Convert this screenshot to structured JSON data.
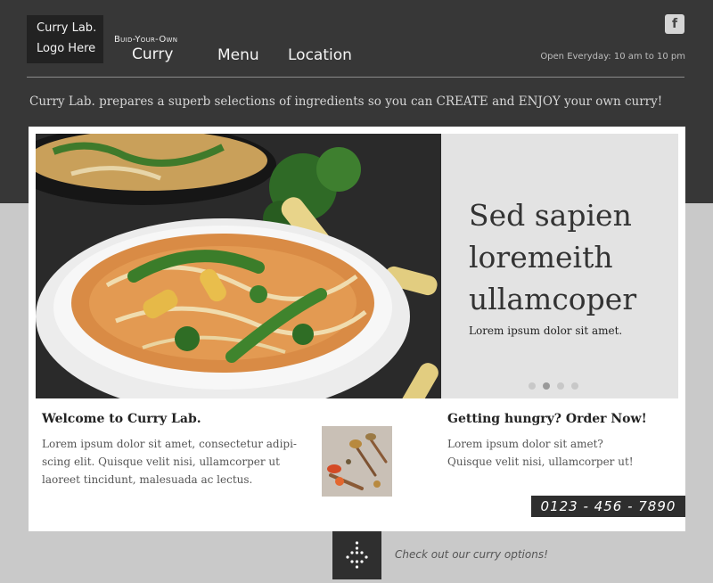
{
  "header": {
    "logo_line1": "Curry Lab.",
    "logo_line2": "Logo Here",
    "nav_build_sub": "Buid-Your-Own",
    "nav_build_main": "Curry",
    "nav_menu": "Menu",
    "nav_location": "Location",
    "social_icon": "facebook-icon",
    "social_glyph": "f",
    "hours": "Open Everyday: 10 am to 10 pm"
  },
  "tagline": "Curry Lab. prepares a superb selections of ingredients so  you can CREATE and ENJOY your own curry!",
  "hero": {
    "headline_line1": "Sed sapien",
    "headline_line2": "loremeith",
    "headline_line3": "ullamcoper",
    "subtext": "Lorem ipsum dolor sit amet.",
    "slide_count": 4,
    "active_slide": 2
  },
  "welcome": {
    "title": "Welcome to Curry Lab.",
    "line1": "Lorem ipsum dolor sit amet, consectetur adipi-",
    "line2": "scing elit. Quisque velit nisi, ullamcorper ut",
    "line3": "laoreet tincidunt, malesuada ac lectus."
  },
  "order": {
    "title": "Getting hungry? Order Now!",
    "line1": "Lorem ipsum dolor sit amet?",
    "line2": "Quisque velit nisi, ullamcorper ut!",
    "phone": "0123 - 456 - 7890"
  },
  "footer": {
    "options_text": "Check out our curry options!",
    "options_icon": "dots-arrow-down-icon"
  },
  "colors": {
    "header_bg": "#373737",
    "page_bg": "#c9c9c9",
    "panel_bg": "#e3e3e3",
    "phone_bg": "#2e2e2e"
  }
}
